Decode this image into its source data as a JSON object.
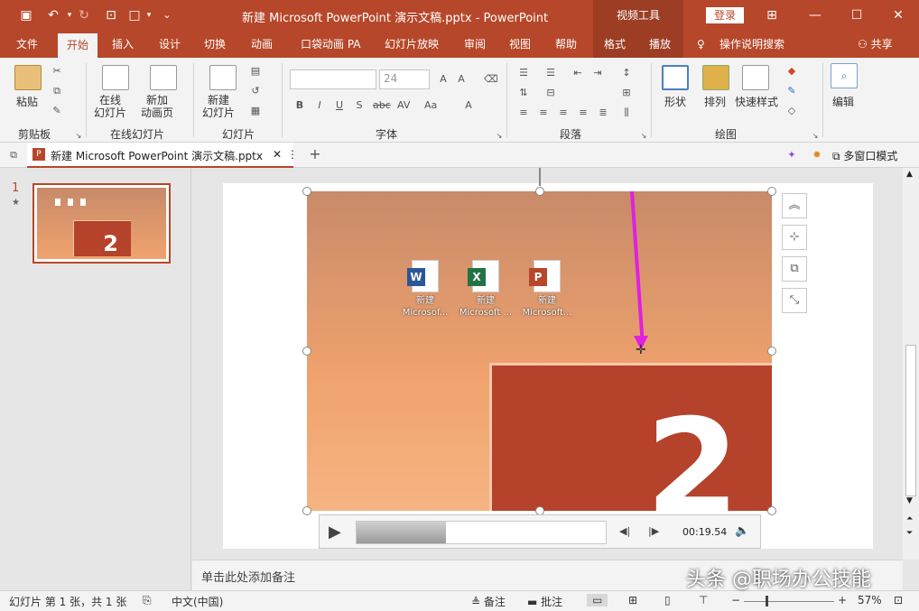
{
  "titlebar": {
    "doc_title": "新建 Microsoft PowerPoint 演示文稿.pptx  -  PowerPoint",
    "video_tools": "视频工具",
    "login": "登录"
  },
  "menu": {
    "file": "文件",
    "home": "开始",
    "insert": "插入",
    "design": "设计",
    "transitions": "切换",
    "animations": "动画",
    "pocket": "口袋动画 PA",
    "slideshow": "幻灯片放映",
    "review": "审阅",
    "view": "视图",
    "help": "帮助",
    "format": "格式",
    "playback": "播放",
    "search": "操作说明搜索",
    "share": "共享"
  },
  "ribbon": {
    "paste": "粘贴",
    "clipboard": "剪贴板",
    "online_slides": "在线\n幻灯片",
    "new_anim_page": "新加\n动画页",
    "online_slides_group": "在线幻灯片",
    "new_slide": "新建\n幻灯片",
    "slides_group": "幻灯片",
    "font_size": "24",
    "font_group": "字体",
    "para_group": "段落",
    "shapes": "形状",
    "arrange": "排列",
    "quick_styles": "快速样式",
    "drawing_group": "绘图",
    "edit": "编辑"
  },
  "doctab": {
    "name": "新建 Microsoft PowerPoint 演示文稿.pptx",
    "multiwindow": "多窗口模式"
  },
  "thumb": {
    "number": "1",
    "star": "★",
    "big_digit": "2"
  },
  "desktop_icons": [
    {
      "badge": "W",
      "color": "#2b579a",
      "cap1": "新建",
      "cap2": "Microsof..."
    },
    {
      "badge": "X",
      "color": "#217346",
      "cap1": "新建",
      "cap2": "Microsoft ..."
    },
    {
      "badge": "P",
      "color": "#b7472a",
      "cap1": "新建",
      "cap2": "Microsoft..."
    }
  ],
  "slide": {
    "big_digit": "2"
  },
  "player": {
    "time": "00:19.54",
    "progress": 0.36
  },
  "notes": {
    "placeholder": "单击此处添加备注"
  },
  "status": {
    "slide_info": "幻灯片 第 1 张，共 1 张",
    "lang": "中文(中国)",
    "notes": "备注",
    "comments": "批注",
    "zoom": "57%"
  },
  "watermark": "头条 @职场办公技能",
  "colors": {
    "accent": "#b7472a",
    "arrow": "#e020e0"
  }
}
